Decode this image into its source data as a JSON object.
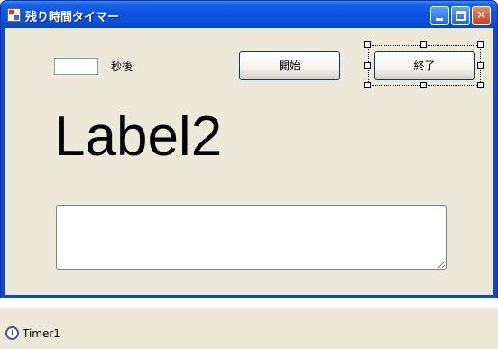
{
  "window": {
    "title": "残り時間タイマー",
    "controls": {
      "minimize": "",
      "maximize": "",
      "close": "✕"
    }
  },
  "form": {
    "seconds_input_value": "",
    "seconds_suffix": "秒後",
    "start_button": "開始",
    "end_button": "終了",
    "big_label": "Label2",
    "text_box_value": ""
  },
  "tray": {
    "timer_label": "Timer1"
  },
  "colors": {
    "titlebar": "#0b55e2",
    "client_bg": "#ece9d8",
    "close_button": "#c6401d"
  }
}
